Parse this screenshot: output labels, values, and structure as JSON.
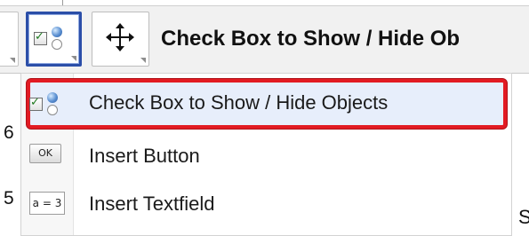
{
  "toolbar": {
    "title": "Check Box to Show / Hide Ob",
    "buttons": [
      {
        "name": "previous-tool",
        "icon": "tool-icon"
      },
      {
        "name": "checkbox-tool",
        "icon": "checkbox-tool-icon",
        "active": true
      },
      {
        "name": "move-graphics-tool",
        "icon": "move-arrows-icon"
      }
    ]
  },
  "menu": {
    "items": [
      {
        "label": "Check Box to Show / Hide Objects",
        "icon": "checkbox-tool-icon",
        "selected": true
      },
      {
        "label": "Insert Button",
        "icon_text": "OK",
        "icon": "button-tool-icon"
      },
      {
        "label": "Insert Textfield",
        "icon_text": "a = 3",
        "icon": "textfield-tool-icon"
      }
    ],
    "highlight_color": "#e21b23"
  },
  "canvas": {
    "left_digits": [
      "6",
      "5"
    ],
    "right_cut_letter": "S"
  },
  "colors": {
    "active_tool_border": "#2b4ea8",
    "selection_background": "#e7eefb"
  }
}
